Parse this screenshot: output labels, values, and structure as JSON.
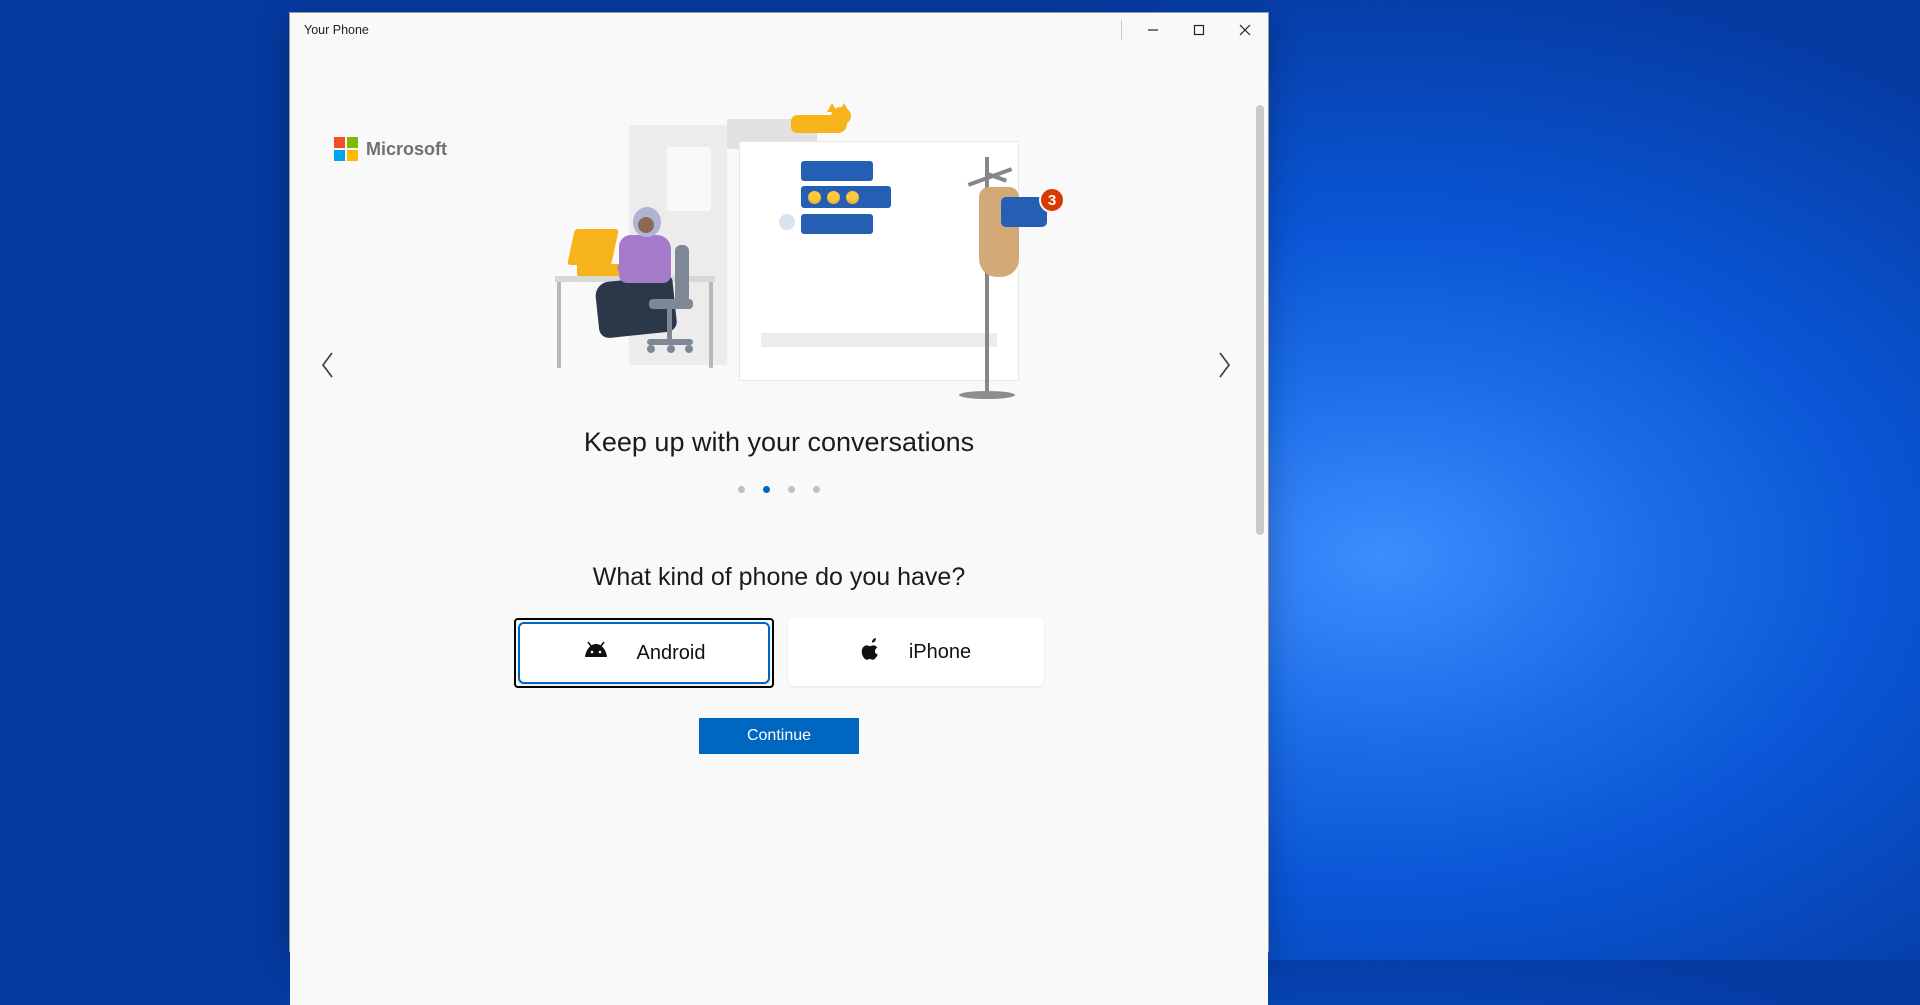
{
  "window": {
    "title": "Your Phone"
  },
  "brand": {
    "name": "Microsoft"
  },
  "notification_badge": "3",
  "carousel": {
    "title": "Keep up with your conversations",
    "active_index": 1,
    "count": 4
  },
  "question": "What kind of phone do you have?",
  "choices": {
    "android": "Android",
    "iphone": "iPhone",
    "selected": "android"
  },
  "continue_label": "Continue"
}
